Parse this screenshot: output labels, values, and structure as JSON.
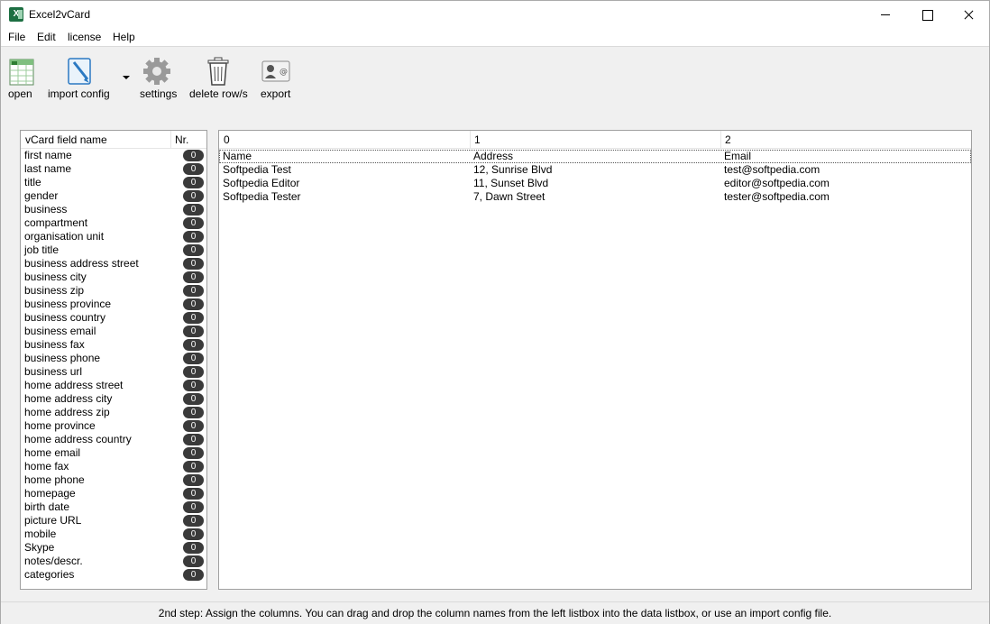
{
  "window": {
    "title": "Excel2vCard"
  },
  "menu": [
    "File",
    "Edit",
    "license",
    "Help"
  ],
  "toolbar": {
    "open": "open",
    "import_config": "import config",
    "settings": "settings",
    "delete_rows": "delete row/s",
    "export": "export"
  },
  "fields_panel": {
    "header_name": "vCard field name",
    "header_nr": "Nr.",
    "items": [
      {
        "label": "first name",
        "nr": "0"
      },
      {
        "label": "last name",
        "nr": "0"
      },
      {
        "label": "title",
        "nr": "0"
      },
      {
        "label": "gender",
        "nr": "0"
      },
      {
        "label": "business",
        "nr": "0"
      },
      {
        "label": "compartment",
        "nr": "0"
      },
      {
        "label": "organisation unit",
        "nr": "0"
      },
      {
        "label": "job title",
        "nr": "0"
      },
      {
        "label": "business address street",
        "nr": "0"
      },
      {
        "label": "business city",
        "nr": "0"
      },
      {
        "label": "business zip",
        "nr": "0"
      },
      {
        "label": "business province",
        "nr": "0"
      },
      {
        "label": "business country",
        "nr": "0"
      },
      {
        "label": "business email",
        "nr": "0"
      },
      {
        "label": "business fax",
        "nr": "0"
      },
      {
        "label": "business phone",
        "nr": "0"
      },
      {
        "label": "business url",
        "nr": "0"
      },
      {
        "label": "home address street",
        "nr": "0"
      },
      {
        "label": "home address city",
        "nr": "0"
      },
      {
        "label": "home address zip",
        "nr": "0"
      },
      {
        "label": "home province",
        "nr": "0"
      },
      {
        "label": "home address country",
        "nr": "0"
      },
      {
        "label": "home email",
        "nr": "0"
      },
      {
        "label": "home fax",
        "nr": "0"
      },
      {
        "label": "home phone",
        "nr": "0"
      },
      {
        "label": "homepage",
        "nr": "0"
      },
      {
        "label": "birth date",
        "nr": "0"
      },
      {
        "label": "picture URL",
        "nr": "0"
      },
      {
        "label": "mobile",
        "nr": "0"
      },
      {
        "label": "Skype",
        "nr": "0"
      },
      {
        "label": "notes/descr.",
        "nr": "0"
      },
      {
        "label": "categories",
        "nr": "0"
      }
    ]
  },
  "data_panel": {
    "columns": [
      "0",
      "1",
      "2"
    ],
    "rows": [
      [
        "Name",
        "Address",
        "Email"
      ],
      [
        "Softpedia Test",
        "12, Sunrise Blvd",
        "test@softpedia.com"
      ],
      [
        "Softpedia Editor",
        "11, Sunset Blvd",
        "editor@softpedia.com"
      ],
      [
        "Softpedia Tester",
        "7, Dawn Street",
        "tester@softpedia.com"
      ]
    ]
  },
  "status": "2nd step: Assign the columns. You can drag and drop the column names from the left listbox into the data listbox, or use an import config file."
}
